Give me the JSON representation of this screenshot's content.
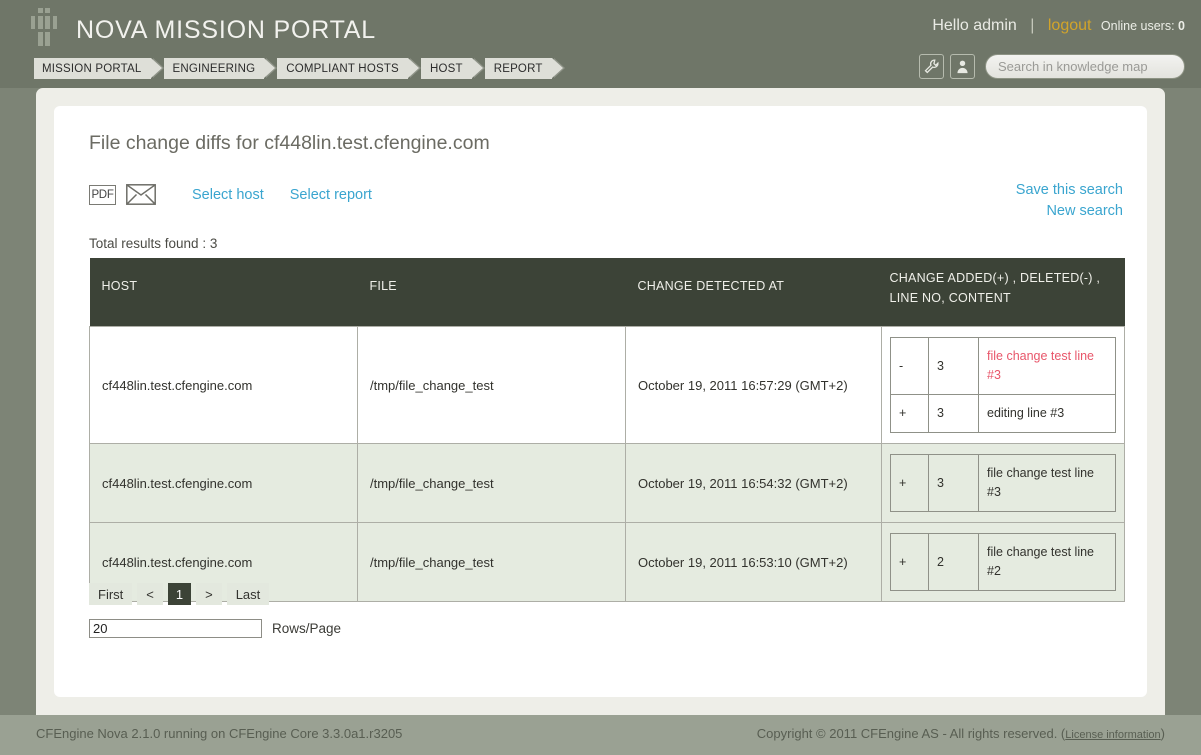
{
  "header": {
    "brand_title": "NOVA MISSION PORTAL",
    "logo_icon": "robot-logo-icon",
    "greeting": "Hello admin",
    "separator": "|",
    "logout_label": "logout",
    "online_users_label": "Online users:",
    "online_users_count": "0",
    "wrench_icon": "wrench-icon",
    "user_icon": "user-icon",
    "search_icon": "search-icon",
    "search_placeholder": "Search in knowledge map",
    "search_value": ""
  },
  "breadcrumb": [
    {
      "label": "MISSION PORTAL"
    },
    {
      "label": "ENGINEERING"
    },
    {
      "label": "COMPLIANT HOSTS"
    },
    {
      "label": "HOST"
    },
    {
      "label": "REPORT"
    }
  ],
  "main": {
    "page_title": "File change diffs for cf448lin.test.cfengine.com",
    "pdf_icon_label": "PDF",
    "mail_icon": "envelope-icon",
    "select_host_label": "Select host",
    "select_report_label": "Select report",
    "save_search_label": "Save this search",
    "new_search_label": "New search",
    "total_results": "Total results found : 3"
  },
  "table": {
    "headers": [
      "HOST",
      "FILE",
      "CHANGE DETECTED AT",
      "CHANGE ADDED(+) , DELETED(-) , LINE NO, CONTENT"
    ],
    "rows": [
      {
        "host": "cf448lin.test.cfengine.com",
        "file": "/tmp/file_change_test",
        "detected_at": "October 19, 2011 16:57:29 (GMT+2)",
        "diffs": [
          {
            "sign": "-",
            "line": "3",
            "content": "file change test line #3",
            "kind": "deleted"
          },
          {
            "sign": "+",
            "line": "3",
            "content": "editing line #3",
            "kind": "added"
          }
        ]
      },
      {
        "host": "cf448lin.test.cfengine.com",
        "file": "/tmp/file_change_test",
        "detected_at": "October 19, 2011 16:54:32 (GMT+2)",
        "diffs": [
          {
            "sign": "+",
            "line": "3",
            "content": "file change test line #3",
            "kind": "plain"
          }
        ]
      },
      {
        "host": "cf448lin.test.cfengine.com",
        "file": "/tmp/file_change_test",
        "detected_at": "October 19, 2011 16:53:10 (GMT+2)",
        "diffs": [
          {
            "sign": "+",
            "line": "2",
            "content": "file change test line #2",
            "kind": "plain"
          }
        ]
      }
    ]
  },
  "pagination": {
    "first_label": "First",
    "prev_label": "<",
    "current_page": "1",
    "next_label": ">",
    "last_label": "Last",
    "rows_per_page_value": "20",
    "rows_per_page_label": "Rows/Page"
  },
  "footer": {
    "left_text": "CFEngine Nova 2.1.0 running on CFEngine Core 3.3.0a1.r3205",
    "right_text": "Copyright © 2011 CFEngine AS - All rights reserved. (",
    "license_link": "License information",
    "right_text_end": ")"
  },
  "colors": {
    "page_bg": "#7d8476",
    "header_bg": "#6f7668",
    "table_header_bg": "#3c4337",
    "link_blue": "#3aa5cf",
    "logout_gold": "#d2a42a",
    "row_green": "#e5ebe0",
    "deleted_red": "#e8566a",
    "footer_bg": "#9aa193"
  }
}
